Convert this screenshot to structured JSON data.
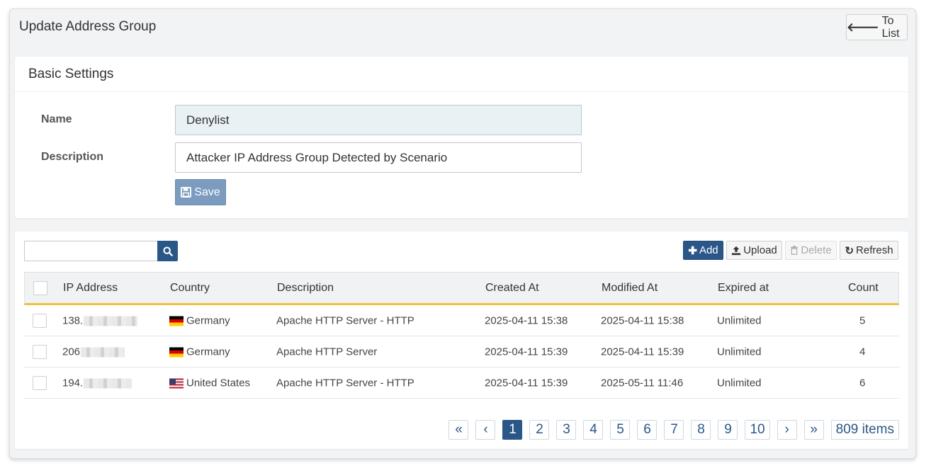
{
  "header": {
    "title": "Update Address Group",
    "to_list_label": "To List"
  },
  "basic": {
    "title": "Basic Settings",
    "name_label": "Name",
    "name_value": "Denylist",
    "desc_label": "Description",
    "desc_value": "Attacker IP Address Group Detected by Scenario",
    "save_label": "Save"
  },
  "toolbar": {
    "search_value": "",
    "add_label": "Add",
    "upload_label": "Upload",
    "delete_label": "Delete",
    "refresh_label": "Refresh"
  },
  "table": {
    "columns": [
      "IP Address",
      "Country",
      "Description",
      "Created At",
      "Modified At",
      "Expired at",
      "Count"
    ],
    "rows": [
      {
        "ip": "138.",
        "country": "Germany",
        "flag": "de",
        "description": "Apache HTTP Server - HTTP",
        "created": "2025-04-11 15:38",
        "modified": "2025-04-11 15:38",
        "expired": "Unlimited",
        "count": "5"
      },
      {
        "ip": "206",
        "country": "Germany",
        "flag": "de",
        "description": "Apache HTTP Server",
        "created": "2025-04-11 15:39",
        "modified": "2025-04-11 15:39",
        "expired": "Unlimited",
        "count": "4"
      },
      {
        "ip": "194.",
        "country": "United States",
        "flag": "us",
        "description": "Apache HTTP Server - HTTP",
        "created": "2025-04-11 15:39",
        "modified": "2025-05-11 11:46",
        "expired": "Unlimited",
        "count": "6"
      }
    ]
  },
  "pagination": {
    "first": "«",
    "prev": "‹",
    "pages": [
      "1",
      "2",
      "3",
      "4",
      "5",
      "6",
      "7",
      "8",
      "9",
      "10"
    ],
    "next": "›",
    "last": "»",
    "total": "809 items",
    "current": "1"
  },
  "colors": {
    "primary": "#2a5788",
    "accent_line": "#f0c040",
    "save_bg": "#7b9bbf"
  }
}
